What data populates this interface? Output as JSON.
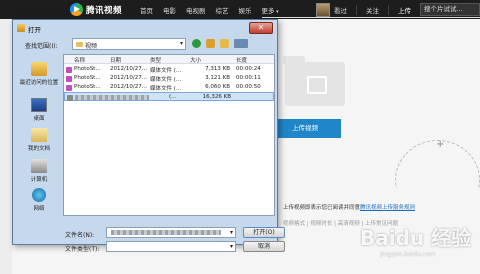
{
  "site": {
    "logo_text": "腾讯视频",
    "nav": [
      "首页",
      "电影",
      "电视剧",
      "综艺",
      "娱乐",
      "更多"
    ],
    "right": {
      "watched": "看过",
      "follow": "关注",
      "upload": "上传",
      "search": "搜个片试试..."
    },
    "upload_button": "上传视频",
    "terms_prefix": "上传视频即表示您已阅读并同意",
    "terms_link": "腾讯视频上传服务规则",
    "tags": "视频格式 | 视频时长 | 高清视频 | 上传常见问题"
  },
  "dialog": {
    "title": "打开",
    "close": "✕",
    "lookin_label": "查找范围(I):",
    "lookin_value": "视频",
    "places": [
      {
        "label": "最近访问的位置",
        "icon": "recent-places-icon"
      },
      {
        "label": "桌面",
        "icon": "desktop-icon"
      },
      {
        "label": "我的文档",
        "icon": "documents-icon"
      },
      {
        "label": "计算机",
        "icon": "computer-icon"
      },
      {
        "label": "网络",
        "icon": "network-icon"
      }
    ],
    "columns": {
      "name": "名称",
      "date": "日期",
      "type": "类型",
      "size": "大小",
      "length": "长度"
    },
    "files": [
      {
        "name": "PhotoSt...",
        "date": "2012/10/27...",
        "type": "媒体文件 (...",
        "size": "7,313 KB",
        "length": "00:00:24"
      },
      {
        "name": "PhotoSt...",
        "date": "2012/10/27...",
        "type": "媒体文件 (...",
        "size": "3,121 KB",
        "length": "00:00:11"
      },
      {
        "name": "PhotoSt...",
        "date": "2012/10/27...",
        "type": "媒体文件 (...",
        "size": "6,060 KB",
        "length": "00:00:50"
      },
      {
        "name": "",
        "date": "",
        "type": "(...",
        "size": "16,326 KB",
        "length": ""
      }
    ],
    "filename_label": "文件名(N):",
    "filetype_label": "文件类型(T):",
    "open_button": "打开(O)",
    "cancel_button": "取消"
  },
  "watermark": {
    "main": "Baidu 经验",
    "sub": "jingyan.baidu.com"
  }
}
